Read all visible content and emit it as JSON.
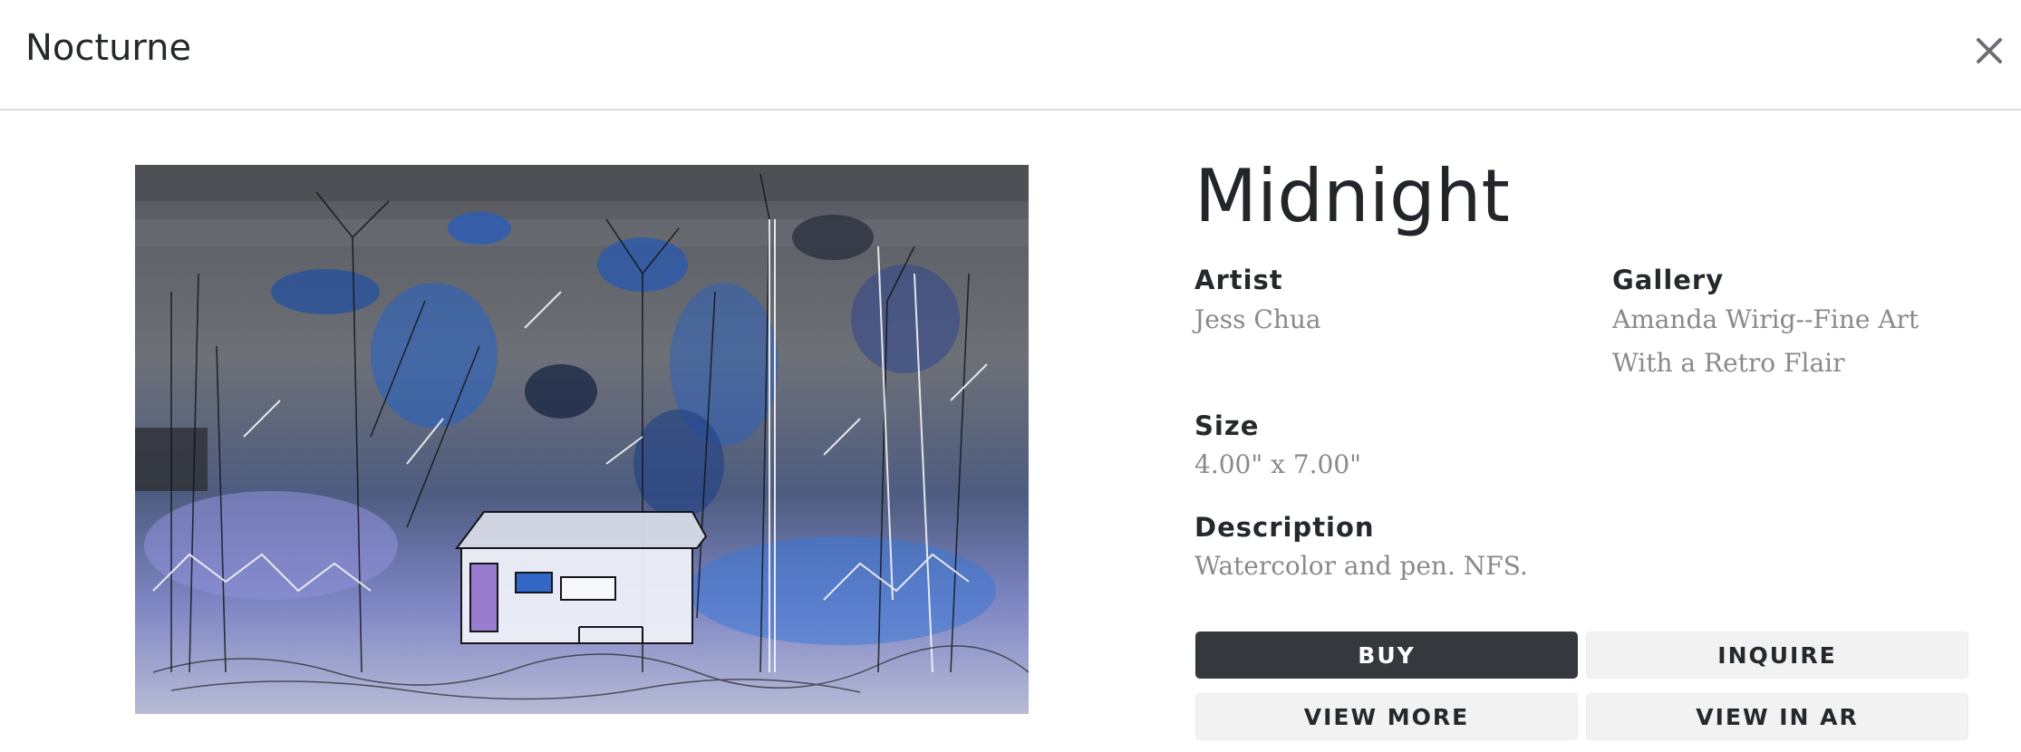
{
  "header": {
    "title": "Nocturne"
  },
  "artwork": {
    "title": "Midnight",
    "artist_label": "Artist",
    "artist": "Jess Chua",
    "gallery_label": "Gallery",
    "gallery": "Amanda Wirig--Fine Art With a Retro Flair",
    "size_label": "Size",
    "size": "4.00\" x 7.00\"",
    "description_label": "Description",
    "description": "Watercolor and pen. NFS."
  },
  "actions": {
    "buy": "BUY",
    "inquire": "INQUIRE",
    "view_more": "VIEW MORE",
    "view_in_ar": "VIEW IN AR"
  },
  "colors": {
    "primary_button": "#35383d",
    "secondary_button": "#f2f2f2",
    "value_text": "#8a8a8a"
  }
}
